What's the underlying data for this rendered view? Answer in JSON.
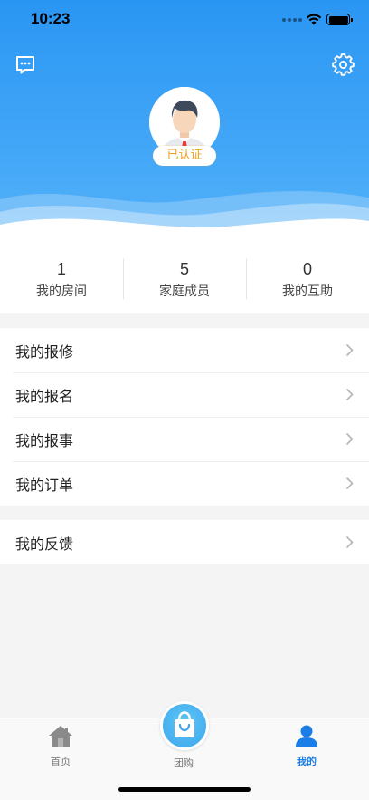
{
  "status_bar": {
    "time": "10:23"
  },
  "profile": {
    "verified_badge": "已认证"
  },
  "stats": [
    {
      "value": "1",
      "label": "我的房间"
    },
    {
      "value": "5",
      "label": "家庭成员"
    },
    {
      "value": "0",
      "label": "我的互助"
    }
  ],
  "menu_group_1": [
    {
      "label": "我的报修"
    },
    {
      "label": "我的报名"
    },
    {
      "label": "我的报事"
    },
    {
      "label": "我的订单"
    }
  ],
  "menu_group_2": [
    {
      "label": "我的反馈"
    }
  ],
  "tabbar": {
    "items": [
      {
        "label": "首页",
        "icon": "home-icon"
      },
      {
        "label": "团购",
        "icon": "shopping-bag-icon"
      },
      {
        "label": "我的",
        "icon": "user-icon",
        "active": true
      }
    ]
  },
  "colors": {
    "header_blue": "#3aa2f6",
    "accent": "#1b7ee8",
    "badge": "#f0a11b"
  }
}
